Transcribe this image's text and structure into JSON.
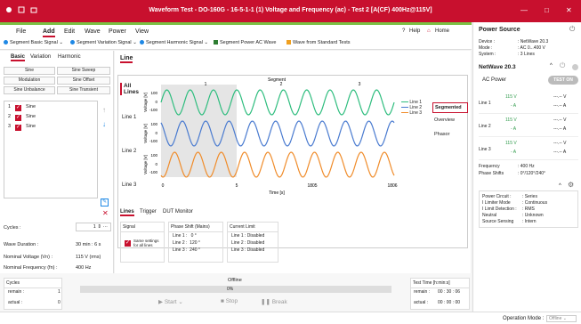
{
  "window": {
    "title": "Waveform Test - DO-160G - 16-5-1-1 (1) Voltage and Frequency (ac) - Test 2 [A(CF) 400Hz@115V]",
    "minimize": "—",
    "maximize": "□",
    "close": "✕"
  },
  "menu": {
    "items": [
      "File",
      "Add",
      "Edit",
      "Wave",
      "Power",
      "View"
    ],
    "help": "Help",
    "home": "Home"
  },
  "ribbon": {
    "items": [
      "Segment Basic Signal",
      "Segment Variation Signal",
      "Segment Harmonic Signal",
      "Segment Power AC Wave",
      "Wave from Standard Tests"
    ]
  },
  "left": {
    "tabs": [
      "Basic",
      "Variation",
      "Harmonic"
    ],
    "buttons": [
      "Sine",
      "Sine Sweep",
      "Modulation",
      "Sine Offset",
      "Sine Unbalance",
      "Sine Transient"
    ],
    "signals": [
      {
        "num": "1",
        "label": "Sine"
      },
      {
        "num": "2",
        "label": "Sine"
      },
      {
        "num": "3",
        "label": "Sine"
      }
    ],
    "cycles_label": "Cycles :",
    "cycles_value": "1",
    "wave_duration_label": "Wave Duration :",
    "wave_duration_value": "30 min : 6 s",
    "nominal_voltage_label": "Nominal Voltage (Vn) :",
    "nominal_voltage_value": "115 V (rms)",
    "nominal_freq_label": "Nominal Frequency (fn) :",
    "nominal_freq_value": "400 Hz"
  },
  "center": {
    "tab": "Line",
    "vtabs": [
      "All Lines",
      "Line 1",
      "Line 2",
      "Line 3"
    ],
    "segment_label": "Segment",
    "segment_numbers": [
      "1",
      "2",
      "3"
    ],
    "ytick_pos": "100",
    "ytick_zero": "0",
    "ytick_neg": "-100",
    "ylabel": "Voltage [V]",
    "xticks": [
      "0",
      "5",
      "1805",
      "1806"
    ],
    "xlabel": "Time [s]",
    "legend": [
      "Line 1",
      "Line 2",
      "Line 3"
    ],
    "side_tabs": [
      "Segmented",
      "Overview",
      "Phasor"
    ],
    "bottom_tabs": [
      "Lines",
      "Trigger",
      "DUT Monitor"
    ],
    "signal_header": "Signal",
    "same_settings": "Same settings for all lines",
    "phase_header": "Phase Shift (Mains)",
    "phases": [
      "Line 1 :   0 °",
      "Line 2 :  120 °",
      "Line 3 :  240 °"
    ],
    "current_header": "Current Limit",
    "currents": [
      "Line 1 : Disabled",
      "Line 2 : Disabled",
      "Line 3 : Disabled"
    ]
  },
  "bottom": {
    "cycles_title": "Cycles",
    "remain_label": "remain :",
    "remain_value": "1",
    "actual_label": "actual :",
    "actual_value": "0",
    "status": "Offline",
    "progress_text": "0%",
    "progress": 0,
    "start": "Start",
    "stop": "Stop",
    "break": "Break",
    "test_time_title": "Test Time [h:min:s]",
    "remain_time": "00 : 30 : 06",
    "actual_time": "00 : 00 : 00"
  },
  "right": {
    "title": "Power Source",
    "device_label": "Device :",
    "device_value": "NetWave 20.3",
    "mode_label": "Mode :",
    "mode_value": "AC 0...400 V",
    "system_label": "System :",
    "system_value": "3 Lines",
    "netwave": "NetWave 20.3",
    "ac_power": "AC Power",
    "test_on": "TEST ON",
    "lines": [
      {
        "name": "Line 1",
        "v": "115 V",
        "a": "- A"
      },
      {
        "name": "Line 2",
        "v": "115 V",
        "a": "- A"
      },
      {
        "name": "Line 3",
        "v": "115 V",
        "a": "- A"
      }
    ],
    "meas_v": "---.-- V",
    "meas_a": "---.-- A",
    "frequency_label": "Frequency",
    "frequency_value": ": 400 Hz",
    "phase_shifts_label": "Phase Shifts",
    "phase_shifts_value": ": 0°/120°/240°",
    "info": [
      [
        "Power Circuit :",
        "Series"
      ],
      [
        "I Limiter Mode",
        ": Continuous"
      ],
      [
        "I Limit Detection :",
        "RMS"
      ],
      [
        "Neutral",
        ": Unknown"
      ],
      [
        "Source Sensing",
        ": Intern"
      ]
    ]
  },
  "status_bar": {
    "label": "Operation Mode :",
    "value": "Offline"
  },
  "colors": {
    "accent": "#c8102e",
    "line1": "#2ebd7e",
    "line2": "#4a7bd0",
    "line3": "#f08c2a",
    "green_bar": "#7bc043"
  }
}
